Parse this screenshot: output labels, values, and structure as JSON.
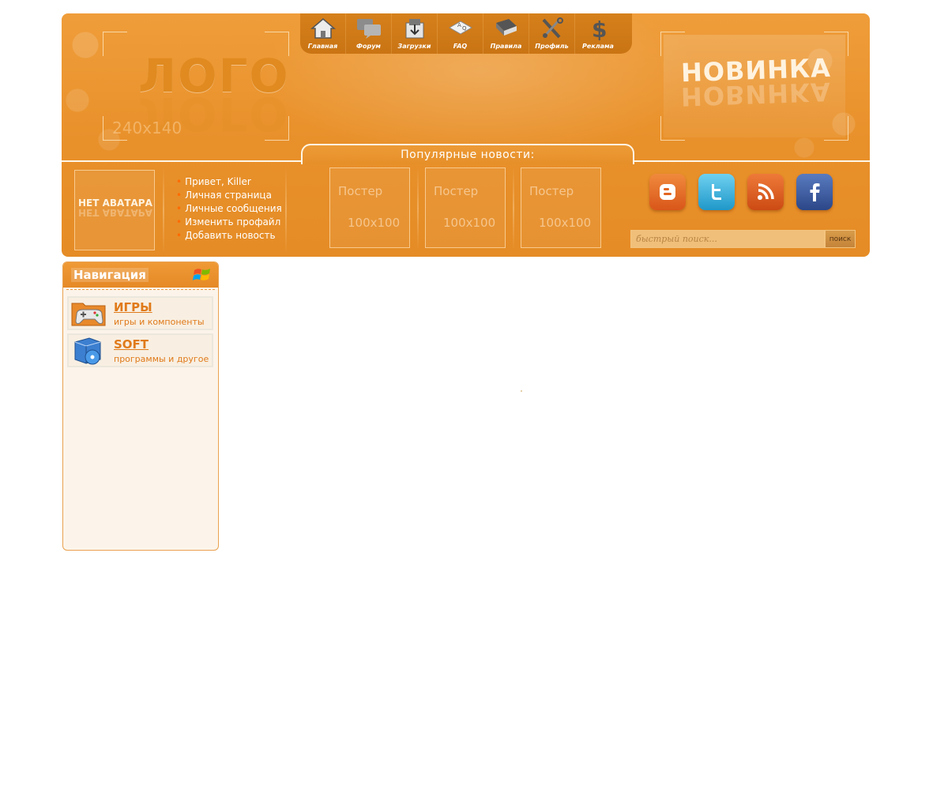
{
  "header": {
    "logo_text": "ЛОГО",
    "logo_size": "240x140",
    "promo_text": "НОВИНКА",
    "popular_news_label": "Популярные новости:",
    "avatar_text": "НЕТ АВАТАРА"
  },
  "topnav": {
    "items": [
      {
        "label": "Главная",
        "icon": "home-icon"
      },
      {
        "label": "Форум",
        "icon": "forum-icon"
      },
      {
        "label": "Загрузки",
        "icon": "downloads-icon"
      },
      {
        "label": "FAQ",
        "icon": "faq-icon"
      },
      {
        "label": "Правила",
        "icon": "rules-book-icon"
      },
      {
        "label": "Профиль",
        "icon": "profile-tools-icon"
      },
      {
        "label": "Реклама",
        "icon": "dollar-icon"
      }
    ]
  },
  "user_menu": {
    "items": [
      "Привет, Killer",
      "Личная страница",
      "Личные сообщения",
      "Изменить профайл",
      "Добавить новость"
    ]
  },
  "posters": [
    {
      "title": "Постер",
      "size": "100x100"
    },
    {
      "title": "Постер",
      "size": "100x100"
    },
    {
      "title": "Постер",
      "size": "100x100"
    }
  ],
  "social": [
    {
      "name": "blogger-icon",
      "color": "#e8691f"
    },
    {
      "name": "twitter-icon",
      "color": "#33b3e0"
    },
    {
      "name": "rss-icon",
      "color": "#e2601c"
    },
    {
      "name": "facebook-icon",
      "color": "#3b5a9a"
    }
  ],
  "search": {
    "placeholder": "быстрый поиск...",
    "button_label": "поиск"
  },
  "sidebar": {
    "title": "Навигация",
    "cards": [
      {
        "title": "ИГРЫ",
        "subtitle": "игры и компоненты",
        "icon": "gamepad-folder-icon"
      },
      {
        "title": "SOFT",
        "subtitle": "программы и другое",
        "icon": "software-box-icon"
      }
    ]
  },
  "colors": {
    "brand_orange": "#e8902a",
    "link_orange": "#e07a1a",
    "sidebar_bg": "#fcf4ea"
  }
}
